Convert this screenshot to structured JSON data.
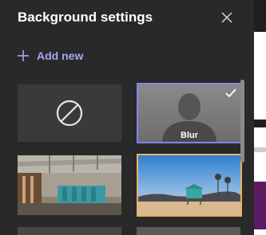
{
  "panel": {
    "title": "Background settings",
    "add_new_label": "Add new"
  },
  "backgrounds": [
    {
      "id": "none",
      "icon": "no-background-icon",
      "selected": false
    },
    {
      "id": "blur",
      "label": "Blur",
      "selected": true,
      "icon": "checkmark-icon"
    },
    {
      "id": "office",
      "selected": false
    },
    {
      "id": "beach",
      "selected": false,
      "focused": true
    }
  ],
  "colors": {
    "panel_bg": "#292929",
    "accent": "#a4a7f3",
    "selected_border": "#7f85f5",
    "focus_border": "#e7b463"
  }
}
